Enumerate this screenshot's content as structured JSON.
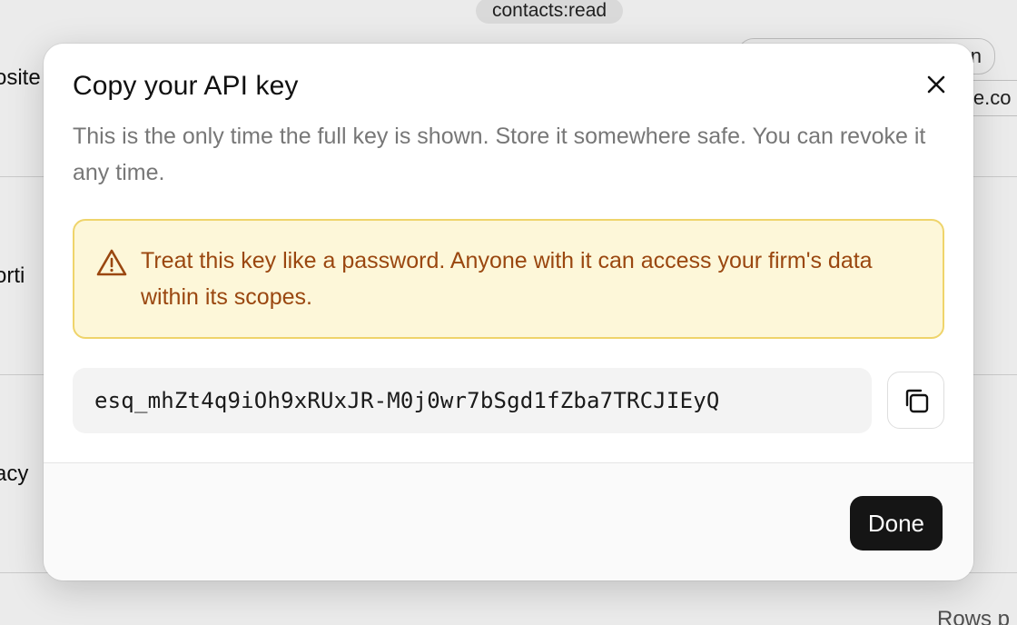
{
  "background": {
    "scope_pill": "contacts:read",
    "outline_pill_tail": "n",
    "side_text_right": "le.co",
    "row_labels": [
      "osite",
      "orti",
      "acy"
    ],
    "bottom_right_text": "Rows p"
  },
  "dialog": {
    "title": "Copy your API key",
    "description": "This is the only time the full key is shown. Store it somewhere safe. You can revoke it any time.",
    "warning": {
      "icon": "warning-triangle-icon",
      "text": "Treat this key like a password. Anyone with it can access your firm's data within its scopes."
    },
    "api_key": "esq_mhZt4q9iOh9xRUxJR-M0j0wr7bSgd1fZba7TRCJIEyQ",
    "copy_icon": "copy-icon",
    "close_icon": "close-icon",
    "done_label": "Done"
  },
  "colors": {
    "warning_bg": "#fdf7d9",
    "warning_border": "#efd46b",
    "warning_text": "#9a4710",
    "primary_button": "#151515"
  }
}
